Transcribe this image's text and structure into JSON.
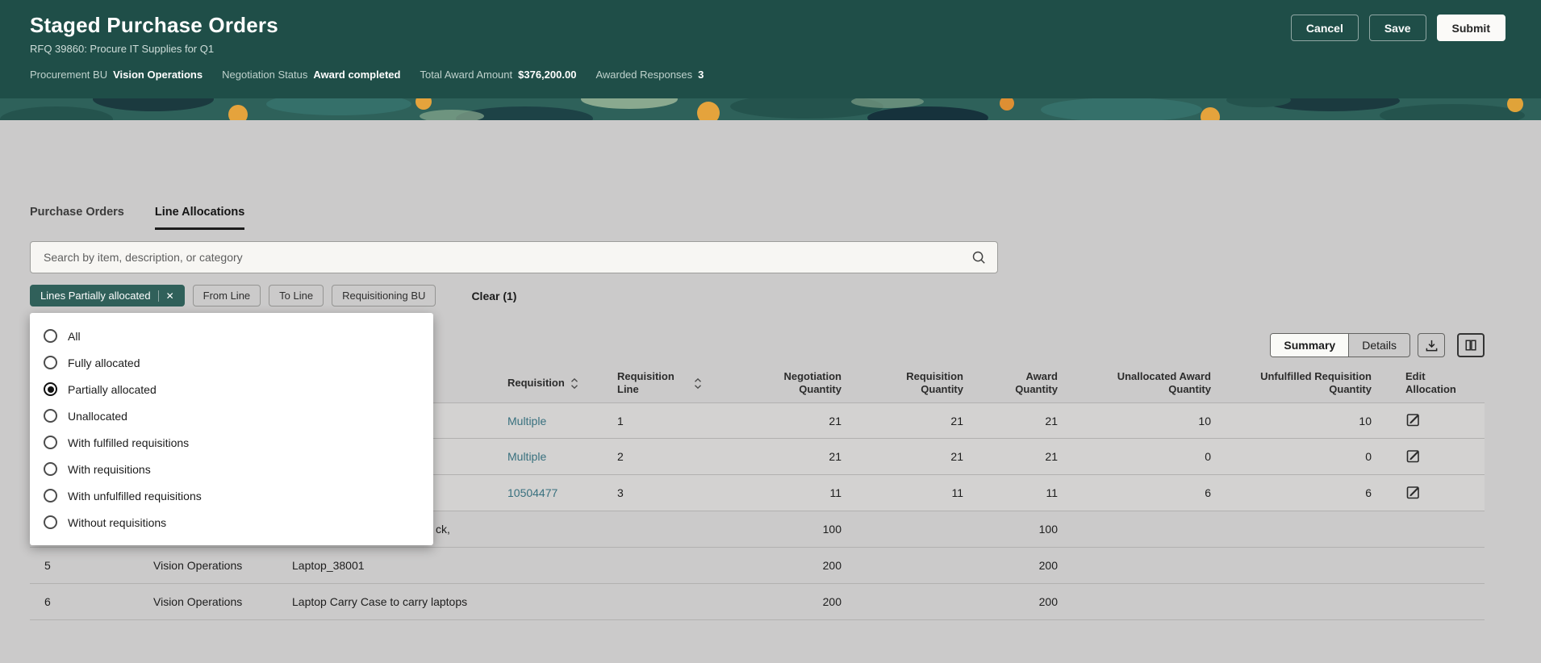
{
  "app": {
    "title": "Staged Purchase Orders",
    "subtitle": "RFQ 39860: Procure IT Supplies for Q1"
  },
  "header_actions": {
    "cancel": "Cancel",
    "save": "Save",
    "submit": "Submit"
  },
  "header_meta": [
    {
      "label": "Procurement BU",
      "value": "Vision Operations"
    },
    {
      "label": "Negotiation Status",
      "value": "Award completed"
    },
    {
      "label": "Total Award Amount",
      "value": "$376,200.00"
    },
    {
      "label": "Awarded Responses",
      "value": "3"
    }
  ],
  "tabs": [
    {
      "label": "Purchase Orders",
      "active": false
    },
    {
      "label": "Line Allocations",
      "active": true
    }
  ],
  "search": {
    "placeholder": "Search by item, description, or category"
  },
  "filter_bar": {
    "selected_chip": {
      "label": "Lines Partially allocated"
    },
    "chips": [
      "From Line",
      "To Line",
      "Requisitioning BU"
    ],
    "clear_label": "Clear (1)"
  },
  "filter_dropdown": {
    "options": [
      {
        "label": "All",
        "selected": false
      },
      {
        "label": "Fully allocated",
        "selected": false
      },
      {
        "label": "Partially allocated",
        "selected": true
      },
      {
        "label": "Unallocated",
        "selected": false
      },
      {
        "label": "With fulfilled requisitions",
        "selected": false
      },
      {
        "label": "With requisitions",
        "selected": false
      },
      {
        "label": "With unfulfilled requisitions",
        "selected": false
      },
      {
        "label": "Without requisitions",
        "selected": false
      }
    ]
  },
  "view_toggle": {
    "summary": "Summary",
    "details": "Details"
  },
  "table": {
    "headers": [
      "",
      "",
      "",
      "Requisition",
      "Requisition Line",
      "Negotiation Quantity",
      "Requisition Quantity",
      "Award Quantity",
      "Unallocated Award Quantity",
      "Unfulfilled Requisition Quantity",
      "Edit Allocation"
    ],
    "rows": [
      {
        "line": "",
        "bu": "",
        "item": "",
        "requisition": "Multiple",
        "requisition_line": "1",
        "negotiation_qty": "21",
        "requisition_qty": "21",
        "award_qty": "21",
        "unallocated_award_qty": "10",
        "unfulfilled_requisition_qty": "10",
        "edit": true
      },
      {
        "line": "",
        "bu": "",
        "item": "",
        "requisition": "Multiple",
        "requisition_line": "2",
        "negotiation_qty": "21",
        "requisition_qty": "21",
        "award_qty": "21",
        "unallocated_award_qty": "0",
        "unfulfilled_requisition_qty": "0",
        "edit": true
      },
      {
        "line": "",
        "bu": "",
        "item": "",
        "requisition": "10504477",
        "requisition_line": "3",
        "negotiation_qty": "11",
        "requisition_qty": "11",
        "award_qty": "11",
        "unallocated_award_qty": "6",
        "unfulfilled_requisition_qty": "6",
        "edit": true
      },
      {
        "line": "",
        "bu": "",
        "item": "ck,",
        "requisition": "",
        "requisition_line": "",
        "negotiation_qty": "100",
        "requisition_qty": "",
        "award_qty": "100",
        "unallocated_award_qty": "",
        "unfulfilled_requisition_qty": "",
        "edit": false
      },
      {
        "line": "5",
        "bu": "Vision Operations",
        "item": "Laptop_38001",
        "requisition": "",
        "requisition_line": "",
        "negotiation_qty": "200",
        "requisition_qty": "",
        "award_qty": "200",
        "unallocated_award_qty": "",
        "unfulfilled_requisition_qty": "",
        "edit": false
      },
      {
        "line": "6",
        "bu": "Vision Operations",
        "item": "Laptop Carry Case to carry laptops",
        "requisition": "",
        "requisition_line": "",
        "negotiation_qty": "200",
        "requisition_qty": "",
        "award_qty": "200",
        "unallocated_award_qty": "",
        "unfulfilled_requisition_qty": "",
        "edit": false
      }
    ]
  },
  "icons": {
    "close": "✕"
  },
  "colors": {
    "header_background": "#1f4e48",
    "selected_chip": "#30605a",
    "link": "#38707e",
    "banner_base": "#2e615a",
    "banner_accent_orange": "#e5a33c"
  }
}
